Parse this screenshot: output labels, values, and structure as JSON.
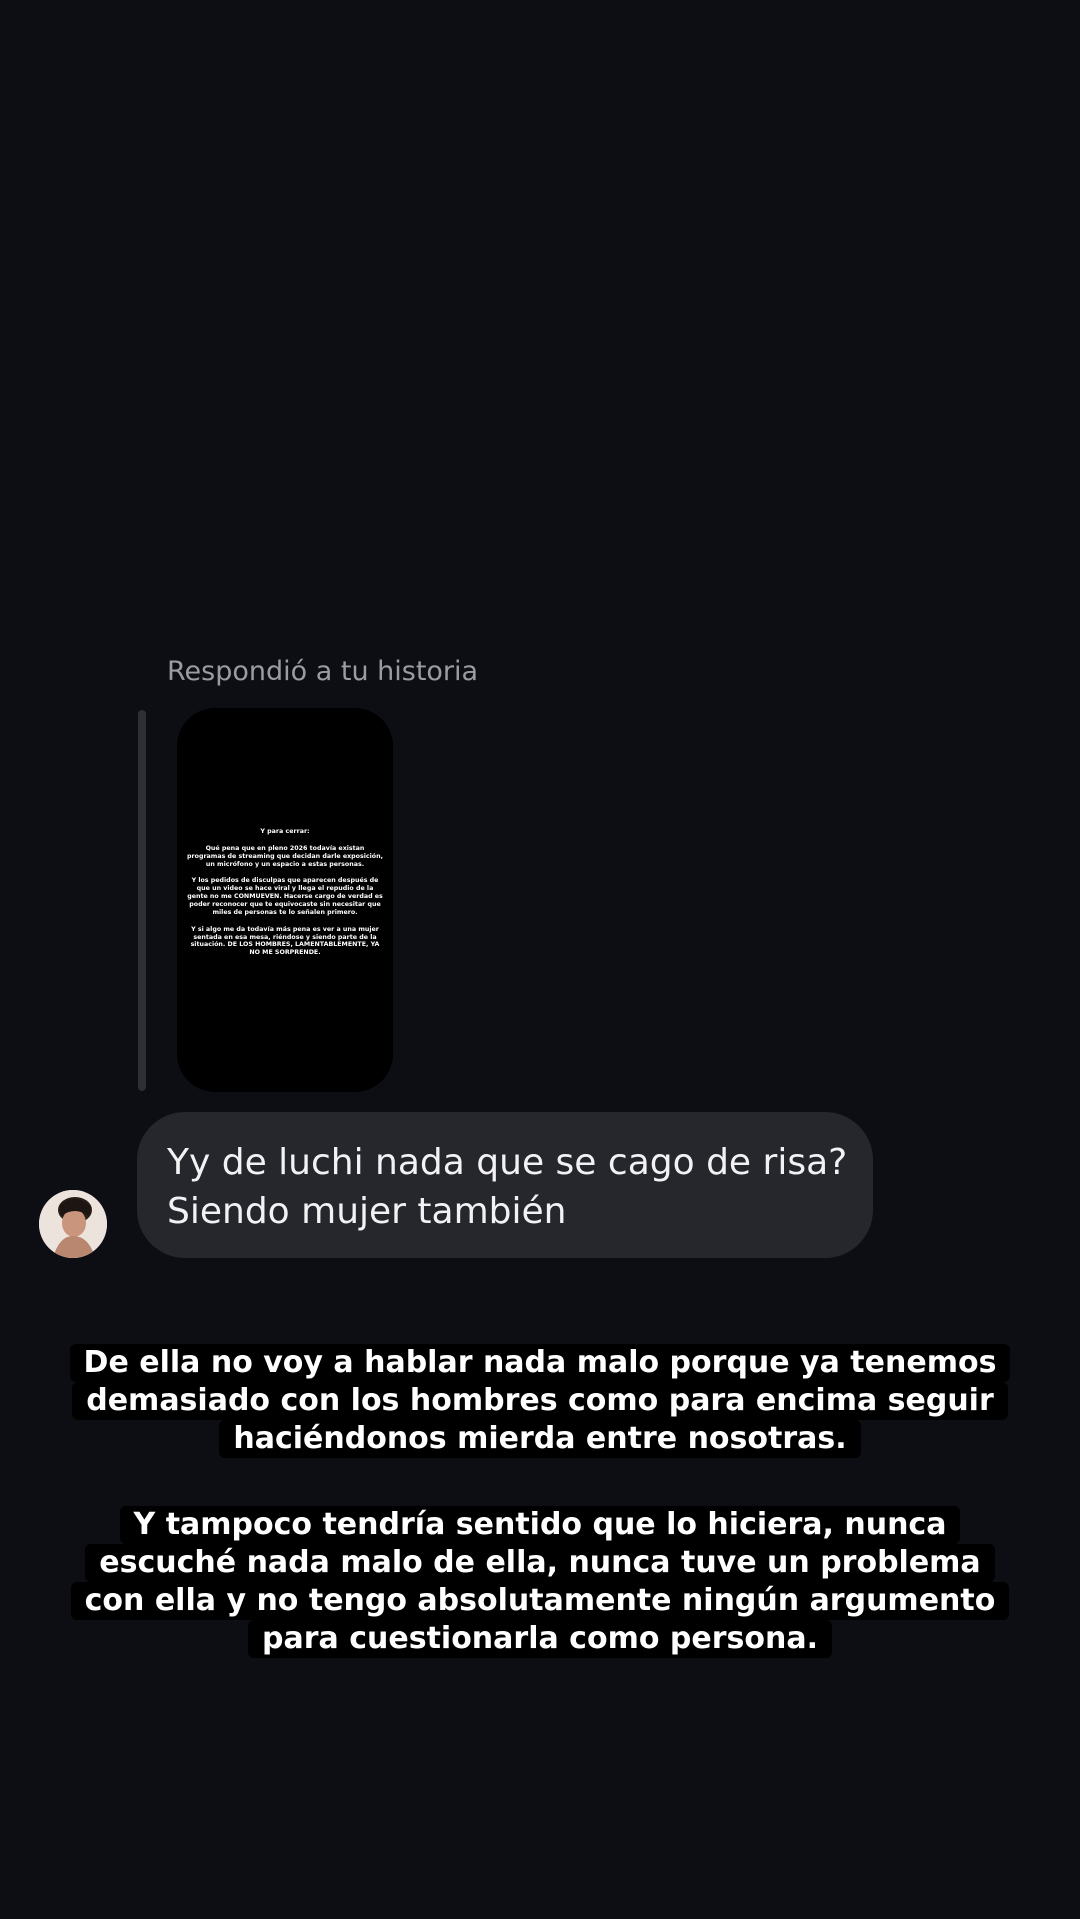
{
  "reply_label": "Respondió a tu historia",
  "story": {
    "paragraphs": [
      "Y para cerrar:",
      "Qué pena que en pleno 2026 todavía existan programas de streaming que decidan darle exposición, un micrófono y un espacio a estas personas.",
      "Y los pedidos de disculpas que aparecen después de que un video se hace viral y llega el repudio de la gente no me CONMUEVEN. Hacerse cargo de verdad es poder reconocer que te equivocaste sin necesitar que miles de personas te lo señalen primero.",
      "Y si algo me da todavía más pena es ver a una mujer sentada en esa mesa, riéndose y siendo parte de la situación. DE LOS HOMBRES, LAMENTABLEMENTE, YA NO ME SORPRENDE."
    ]
  },
  "message": {
    "lines": [
      "Yy de luchi nada que se cago de risa?",
      "Siendo mujer también"
    ]
  },
  "caption_1": {
    "lines": [
      "De ella no voy a hablar nada malo porque ya tenemos",
      "demasiado con los hombres como para encima seguir",
      "haciéndonos mierda entre nosotras."
    ]
  },
  "caption_2": {
    "lines": [
      "Y tampoco tendría sentido que lo hiciera, nunca",
      "escuché nada malo de ella, nunca tuve un problema",
      "con ella y no tengo absolutamente ningún argumento",
      "para cuestionarla como persona."
    ]
  },
  "colors": {
    "background": "#0c0e13",
    "bubble": "#25272d",
    "caption_bg": "#000000",
    "label": "#9a9ca3"
  }
}
